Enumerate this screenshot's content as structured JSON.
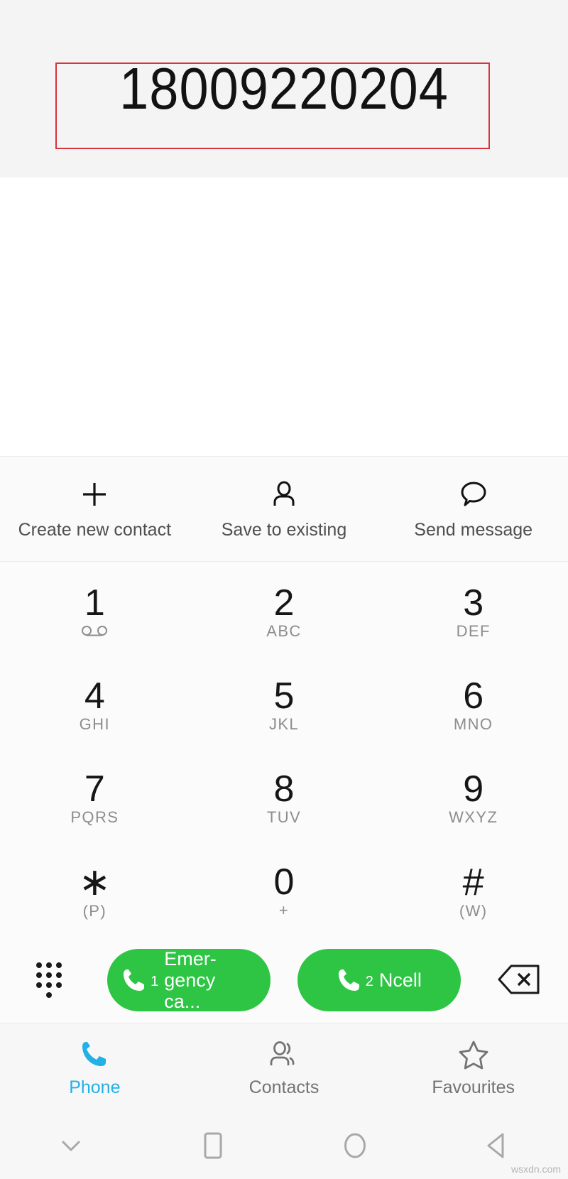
{
  "display": {
    "phone_number": "18009220204",
    "annotation_color": "#d9333f",
    "background": "#f4f4f4"
  },
  "actions": [
    {
      "label": "Create new contact",
      "icon": "plus-icon"
    },
    {
      "label": "Save to existing",
      "icon": "person-icon"
    },
    {
      "label": "Send message",
      "icon": "speech-bubble-icon"
    }
  ],
  "keypad": {
    "rows": [
      [
        {
          "digit": "1",
          "sub": "",
          "icon": "voicemail-icon"
        },
        {
          "digit": "2",
          "sub": "ABC",
          "icon": ""
        },
        {
          "digit": "3",
          "sub": "DEF",
          "icon": ""
        }
      ],
      [
        {
          "digit": "4",
          "sub": "GHI",
          "icon": ""
        },
        {
          "digit": "5",
          "sub": "JKL",
          "icon": ""
        },
        {
          "digit": "6",
          "sub": "MNO",
          "icon": ""
        }
      ],
      [
        {
          "digit": "7",
          "sub": "PQRS",
          "icon": ""
        },
        {
          "digit": "8",
          "sub": "TUV",
          "icon": ""
        },
        {
          "digit": "9",
          "sub": "WXYZ",
          "icon": ""
        }
      ],
      [
        {
          "digit": "∗",
          "sub": "(P)",
          "icon": ""
        },
        {
          "digit": "0",
          "sub": "+",
          "icon": ""
        },
        {
          "digit": "#",
          "sub": "(W)",
          "icon": ""
        }
      ]
    ]
  },
  "call_row": {
    "dialpad_toggle_icon": "dialpad-dots-icon",
    "delete_icon": "backspace-icon",
    "buttons": [
      {
        "sim": "1",
        "label": "Emer-gency ca...",
        "color": "#2ec544"
      },
      {
        "sim": "2",
        "label": "Ncell",
        "color": "#2ec544"
      }
    ]
  },
  "tabs": [
    {
      "label": "Phone",
      "icon": "phone-icon",
      "active": true,
      "color": "#23b0e6"
    },
    {
      "label": "Contacts",
      "icon": "contacts-icon",
      "active": false,
      "color": "#737373"
    },
    {
      "label": "Favourites",
      "icon": "star-icon",
      "active": false,
      "color": "#737373"
    }
  ],
  "system_nav": [
    {
      "icon": "chevron-down-icon"
    },
    {
      "icon": "square-recents-icon"
    },
    {
      "icon": "circle-home-icon"
    },
    {
      "icon": "triangle-back-icon"
    }
  ],
  "watermark": "wsxdn.com"
}
